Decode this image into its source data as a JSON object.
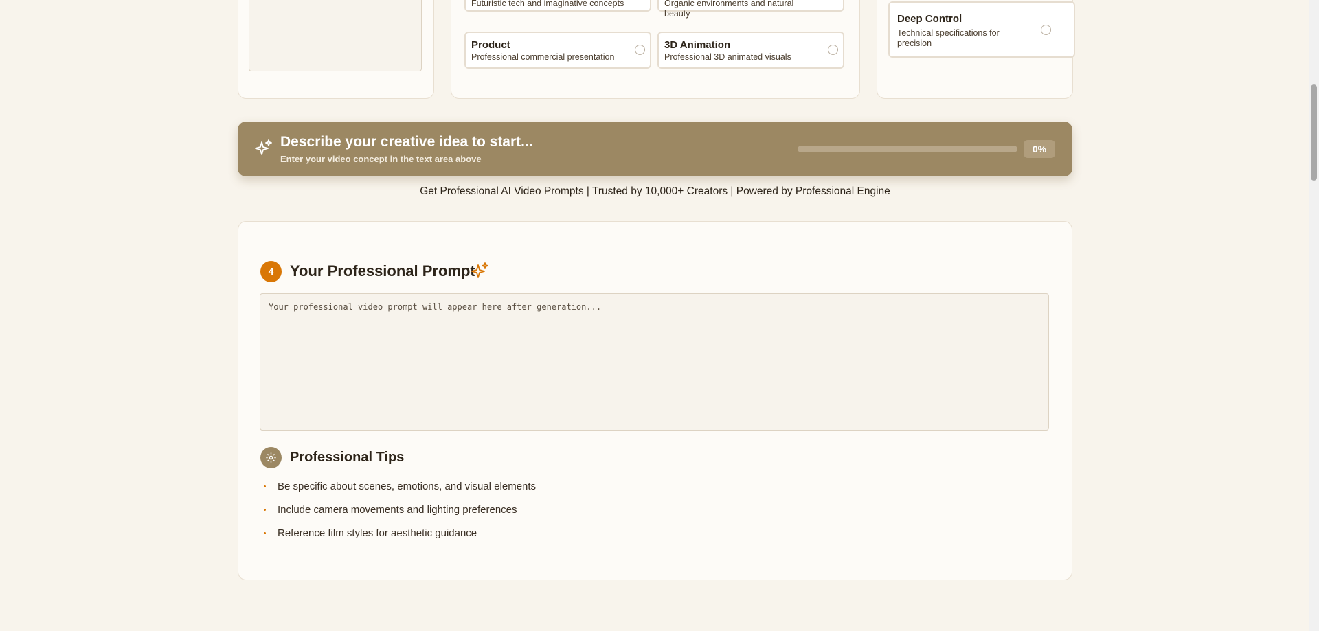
{
  "styles": {
    "top_cards": [
      {
        "title": "",
        "desc": "Futuristic tech and imaginative concepts"
      },
      {
        "title": "",
        "desc": "Organic environments and natural beauty"
      },
      {
        "title": "Product",
        "desc": "Professional commercial presentation"
      },
      {
        "title": "3D Animation",
        "desc": "Professional 3D animated visuals"
      }
    ]
  },
  "control": {
    "card": {
      "title": "Deep Control",
      "desc": "Technical specifications for precision"
    }
  },
  "banner": {
    "title": "Describe your creative idea to start...",
    "subtitle": "Enter your video concept in the text area above",
    "progress_value": 0,
    "progress_label": "0%"
  },
  "tagline": "Get Professional AI Video Prompts | Trusted by 10,000+ Creators | Powered by Professional Engine",
  "prompt_section": {
    "step": "4",
    "title": "Your Professional Prompt",
    "placeholder": "Your professional video prompt will appear here after generation..."
  },
  "tips": {
    "title": "Professional Tips",
    "items": [
      "Be specific about scenes, emotions, and visual elements",
      "Include camera movements and lighting preferences",
      "Reference film styles for aesthetic guidance"
    ]
  },
  "colors": {
    "accent": "#d97706",
    "banner": "#9c8863",
    "background": "#f8f4ec"
  }
}
